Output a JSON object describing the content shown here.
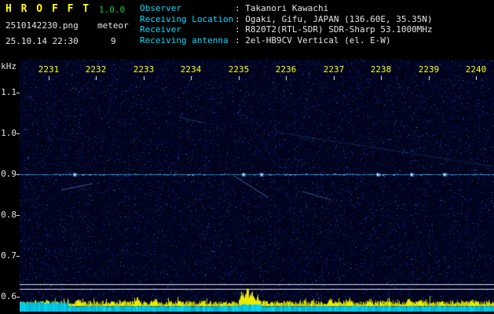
{
  "header": {
    "app_title": "H R O F F T",
    "version": "1.0.0",
    "filename": "2510142230.png",
    "mode": "meteor",
    "datetime": "25.10.14 22:30",
    "count": "9",
    "info": [
      {
        "label": "Observer",
        "value": ": Takanori Kawachi"
      },
      {
        "label": "Receiving Location",
        "value": ": Ogaki, Gifu, JAPAN (136.60E, 35.35N)"
      },
      {
        "label": "Receiver",
        "value": ": R820T2(RTL-SDR) SDR-Sharp 53.1000MHz"
      },
      {
        "label": "Receiving antenna",
        "value": ": 2el-HB9CV Vertical (el. E-W)"
      }
    ]
  },
  "axes": {
    "y_unit": "kHz",
    "y_ticks": [
      "1.1",
      "1.0",
      "0.9",
      "0.8",
      "0.7",
      "0.6"
    ],
    "x_ticks": [
      "2231",
      "2232",
      "2233",
      "2234",
      "2235",
      "2236",
      "2237",
      "2238",
      "2239",
      "2240"
    ]
  },
  "colors": {
    "title": "#ffff00",
    "version": "#00cc44",
    "text": "#e6e6e6",
    "label_cyan": "#00dcff",
    "time_label": "#ffff00",
    "axis_label": "#e6e6e6",
    "noise_bg": "#000119",
    "echo": "#59c3ff",
    "level_line": "#dedeeb",
    "spikes": "#ebeb00",
    "band": "#00c8dc"
  },
  "signal": {
    "echo_line_khz": 0.9,
    "streaks": [
      [
        78,
        242,
        118,
        234,
        0.5
      ],
      [
        230,
        150,
        262,
        157,
        0.25
      ],
      [
        298,
        224,
        342,
        252,
        0.55
      ],
      [
        385,
        244,
        420,
        254,
        0.4
      ],
      [
        350,
        168,
        628,
        212,
        0.18
      ]
    ],
    "blobs_x": [
      95,
      310,
      333,
      481,
      524,
      566
    ],
    "peaks": [
      [
        60,
        9
      ],
      [
        100,
        11
      ],
      [
        142,
        8
      ],
      [
        175,
        12
      ],
      [
        197,
        10
      ],
      [
        258,
        9
      ],
      [
        308,
        20
      ],
      [
        315,
        26
      ],
      [
        321,
        22
      ],
      [
        328,
        15
      ],
      [
        420,
        12
      ],
      [
        445,
        10
      ],
      [
        470,
        9
      ],
      [
        520,
        11
      ],
      [
        535,
        10
      ],
      [
        562,
        8
      ],
      [
        600,
        9
      ]
    ]
  }
}
